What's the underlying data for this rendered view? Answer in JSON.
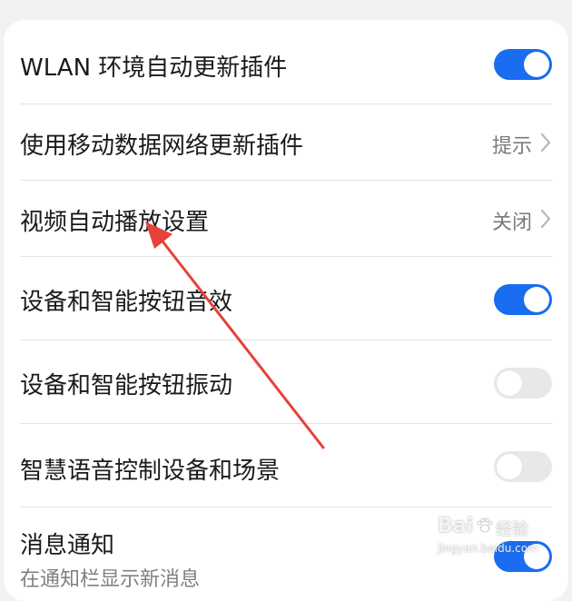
{
  "settings": {
    "rows": [
      {
        "label": "WLAN 环境自动更新插件",
        "control": "toggle",
        "state": "on"
      },
      {
        "label": "使用移动数据网络更新插件",
        "control": "value",
        "value": "提示"
      },
      {
        "label": "视频自动播放设置",
        "control": "value",
        "value": "关闭"
      },
      {
        "label": "设备和智能按钮音效",
        "control": "toggle",
        "state": "on"
      },
      {
        "label": "设备和智能按钮振动",
        "control": "toggle",
        "state": "off"
      },
      {
        "label": "智慧语音控制设备和场景",
        "control": "toggle",
        "state": "off"
      },
      {
        "label": "消息通知",
        "sublabel": "在通知栏显示新消息",
        "control": "toggle",
        "state": "on"
      }
    ]
  },
  "colors": {
    "toggle_on": "#1a6cf0",
    "toggle_off": "#e8e8ea",
    "arrow": "#e8403a"
  },
  "watermark": {
    "brand": "Bai",
    "suffix": "经验",
    "url": "jingyan.baidu.com"
  }
}
